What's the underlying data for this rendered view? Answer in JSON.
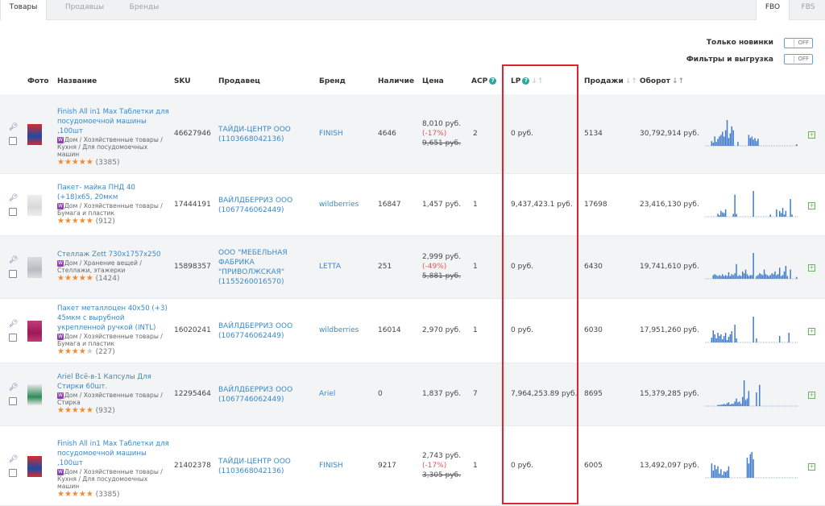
{
  "tabs": [
    {
      "label": "Товары"
    },
    {
      "label": "Продавцы"
    },
    {
      "label": "Бренды"
    }
  ],
  "modes": [
    {
      "label": "FBO"
    },
    {
      "label": "FBS"
    }
  ],
  "toggles": {
    "new_only_label": "Только новинки",
    "filters_label": "Фильтры и выгрузка",
    "off": "OFF"
  },
  "columns": {
    "photo": "Фото",
    "name": "Название",
    "sku": "SKU",
    "seller": "Продавец",
    "brand": "Бренд",
    "stock": "Наличие",
    "price": "Цена",
    "acp": "АСР",
    "lp": "LP",
    "sales": "Продажи",
    "turnover": "Оборот"
  },
  "icons": {
    "badge": "?",
    "sort": "↓↑",
    "expand": "+",
    "key": "key-icon"
  },
  "rows": [
    {
      "name": "Finish All in1 Max Таблетки для посудомоечной машины ,100шт",
      "category": "Дом / Хозяйственные товары / Кухня / Для посудомоечных машин",
      "rating": 5,
      "reviews": "(3385)",
      "sku": "46627946",
      "seller": "ТАЙДИ-ЦЕНТР ООО (1103668042136)",
      "brand": "FINISH",
      "stock": "4646",
      "price": "8,010 руб.",
      "discount": "(-17%)",
      "old_price": "9,651 руб.",
      "acp": "2",
      "lp": "0 руб.",
      "sales": "5134",
      "turnover": "30,792,914 руб.",
      "spark": [
        0,
        0,
        0,
        0,
        6,
        4,
        12,
        5,
        9,
        12,
        14,
        18,
        12,
        20,
        33,
        10,
        16,
        25,
        20,
        0,
        0,
        5,
        0,
        0,
        0,
        0,
        0,
        0,
        14,
        10,
        12,
        8,
        10,
        6,
        9,
        0,
        0,
        0,
        0,
        0,
        0,
        0,
        0,
        0,
        0,
        0,
        0,
        0,
        0,
        0,
        0,
        0,
        0,
        0,
        0,
        0,
        0,
        0,
        0,
        2
      ]
    },
    {
      "name": "Пакет- майка ПНД 40 (+18)x65, 20мкм",
      "category": "Дом / Хозяйственные товары / Бумага и пластик",
      "rating": 5,
      "reviews": "(912)",
      "sku": "17444191",
      "seller": "ВАЙЛДБЕРРИЗ ООО (1067746062449)",
      "brand": "wildberries",
      "stock": "16847",
      "price": "1,457 руб.",
      "discount": "",
      "old_price": "",
      "acp": "1",
      "lp": "9,437,423.1 руб.",
      "sales": "17698",
      "turnover": "23,416,130 руб.",
      "spark": [
        0,
        0,
        0,
        0,
        0,
        0,
        0,
        0,
        4,
        2,
        8,
        6,
        5,
        10,
        0,
        0,
        0,
        0,
        4,
        30,
        4,
        0,
        0,
        0,
        0,
        0,
        0,
        0,
        0,
        0,
        0,
        35,
        0,
        0,
        0,
        0,
        0,
        0,
        0,
        0,
        0,
        0,
        3,
        0,
        0,
        0,
        10,
        0,
        8,
        5,
        12,
        3,
        8,
        0,
        0,
        24,
        3,
        0,
        0,
        0
      ]
    },
    {
      "name": "Стеллаж Zett 730x1757x250",
      "category": "Дом / Хранение вещей / Стеллажи, этажерки",
      "rating": 5,
      "reviews": "(1424)",
      "sku": "15898357",
      "seller": "ООО \"МЕБЕЛЬНАЯ ФАБРИКА \"ПРИВОЛЖСКАЯ\" (1155260016570)",
      "brand": "LETTA",
      "stock": "251",
      "price": "2,999 руб.",
      "discount": "(-49%)",
      "old_price": "5,881 руб.",
      "acp": "1",
      "lp": "0 руб.",
      "sales": "6430",
      "turnover": "19,741,610 руб.",
      "spark": [
        0,
        0,
        0,
        0,
        0,
        4,
        5,
        4,
        3,
        4,
        3,
        5,
        3,
        4,
        3,
        7,
        3,
        5,
        4,
        6,
        16,
        3,
        4,
        3,
        8,
        6,
        10,
        5,
        3,
        4,
        4,
        28,
        0,
        3,
        4,
        6,
        5,
        4,
        10,
        5,
        4,
        3,
        4,
        6,
        5,
        8,
        4,
        5,
        12,
        3,
        4,
        8,
        14,
        3,
        0,
        10,
        0,
        0,
        0,
        2
      ]
    },
    {
      "name": "Пакет металлоцен 40x50 (+3) 45мкм с вырубной укрепленной ручкой (INTL)",
      "category": "Дом / Хозяйственные товары / Бумага и пластик",
      "rating": 4,
      "reviews": "(227)",
      "sku": "16020241",
      "seller": "ВАЙЛДБЕРРИЗ ООО (1067746062449)",
      "brand": "wildberries",
      "stock": "16014",
      "price": "2,970 руб.",
      "discount": "",
      "old_price": "",
      "acp": "1",
      "lp": "0 руб.",
      "sales": "6030",
      "turnover": "17,951,260 руб.",
      "spark": [
        0,
        0,
        0,
        0,
        6,
        15,
        10,
        5,
        12,
        8,
        10,
        4,
        8,
        12,
        3,
        7,
        10,
        14,
        0,
        22,
        5,
        0,
        0,
        0,
        0,
        0,
        0,
        0,
        0,
        0,
        0,
        32,
        0,
        5,
        0,
        0,
        0,
        0,
        0,
        0,
        0,
        0,
        0,
        0,
        0,
        0,
        0,
        0,
        8,
        0,
        0,
        0,
        0,
        0,
        12,
        0,
        0,
        0,
        0,
        0
      ]
    },
    {
      "name": "Ariel Всё-в-1 Капсулы Для Стирки 60шт.",
      "category": "Дом / Хозяйственные товары / Стирка",
      "rating": 5,
      "reviews": "(932)",
      "sku": "12295464",
      "seller": "ВАЙЛДБЕРРИЗ ООО (1067746062449)",
      "brand": "Ariel",
      "stock": "0",
      "price": "1,837 руб.",
      "discount": "",
      "old_price": "",
      "acp": "7",
      "lp": "7,964,253.89 руб.",
      "sales": "8695",
      "turnover": "15,379,285 руб.",
      "spark": [
        0,
        0,
        0,
        0,
        0,
        0,
        0,
        0,
        1,
        1,
        2,
        2,
        3,
        2,
        4,
        5,
        2,
        3,
        3,
        6,
        10,
        5,
        6,
        3,
        12,
        34,
        8,
        10,
        20,
        0,
        0,
        0,
        0,
        18,
        0,
        28,
        0,
        0,
        0,
        0,
        0,
        0,
        0,
        0,
        0,
        0,
        0,
        0,
        0,
        0,
        0,
        0,
        0,
        0,
        0,
        0,
        0,
        0,
        0,
        0
      ]
    },
    {
      "name": "Finish All in1 Max Таблетки для посудомоечной машины ,100шт",
      "category": "Дом / Хозяйственные товары / Кухня / Для посудомоечных машин",
      "rating": 5,
      "reviews": "(3385)",
      "sku": "21402378",
      "seller": "ТАЙДИ-ЦЕНТР ООО (1103668042136)",
      "brand": "FINISH",
      "stock": "9217",
      "price": "2,743 руб.",
      "discount": "(-17%)",
      "old_price": "3,305 руб.",
      "acp": "1",
      "lp": "0 руб.",
      "sales": "6005",
      "turnover": "13,492,097 руб.",
      "spark": [
        0,
        0,
        0,
        0,
        20,
        10,
        18,
        12,
        16,
        6,
        12,
        4,
        9,
        8,
        10,
        16,
        0,
        0,
        0,
        0,
        0,
        0,
        0,
        0,
        0,
        0,
        0,
        28,
        20,
        33,
        36,
        26,
        0,
        0,
        0,
        0,
        0,
        0,
        0,
        0,
        0,
        0,
        0,
        0,
        0,
        0,
        0,
        0,
        0,
        0,
        0,
        0,
        0,
        0,
        0,
        0,
        0,
        0,
        0,
        0
      ]
    }
  ]
}
